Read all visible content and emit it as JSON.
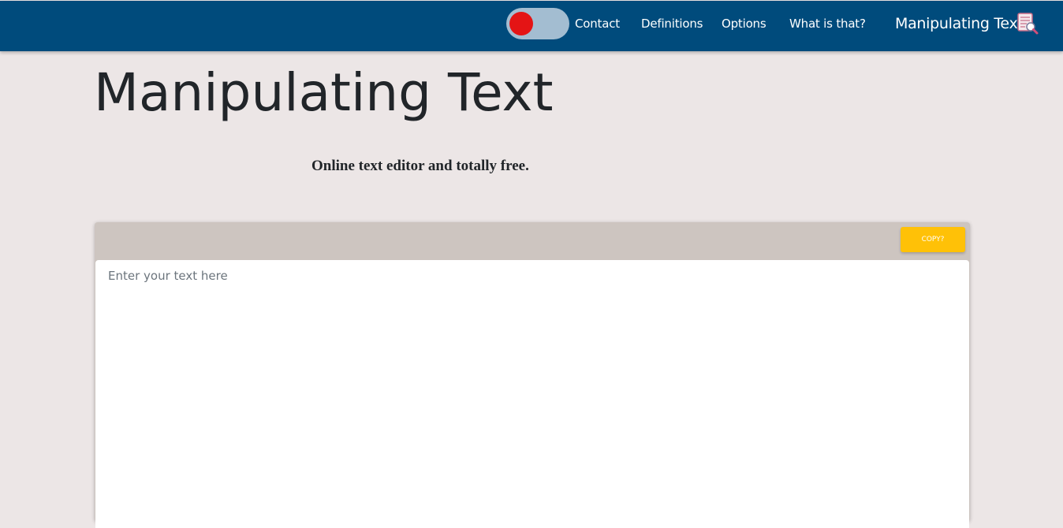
{
  "nav": {
    "links": [
      "Contact",
      "Definitions",
      "Options",
      "What is that?"
    ],
    "brand": "Manipulating Text",
    "brand_icon": "document-edit-icon",
    "toggle": {
      "state": "off",
      "knob_color": "#e41415",
      "track_color": "#a3bdd1"
    },
    "background": "#004b7c"
  },
  "main": {
    "title": "Manipulating Text",
    "subtitle": "Online text editor and totally free."
  },
  "editor": {
    "copy_label": "COPY?",
    "copy_color": "#ffc107",
    "placeholder": "Enter your text here",
    "value": ""
  }
}
